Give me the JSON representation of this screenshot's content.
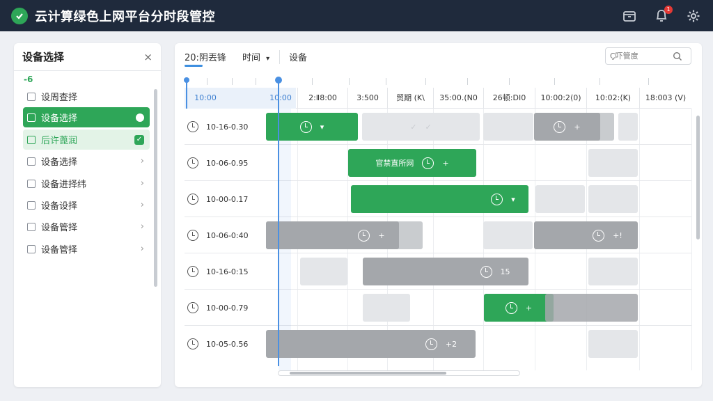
{
  "app": {
    "title": "云计算绿色上网平台分时段管控",
    "notification_count": "1"
  },
  "sidebar": {
    "title": "设备选择",
    "close": "×",
    "subtitle": "-6",
    "items": [
      {
        "label": "设周查择",
        "state": "normal",
        "trail": ""
      },
      {
        "label": "设备选择",
        "state": "active",
        "trail": ""
      },
      {
        "label": "后许蓖润",
        "state": "soft",
        "trail": "✓"
      },
      {
        "label": "设备选择",
        "state": "normal",
        "trail": "›"
      },
      {
        "label": "设备进择纬",
        "state": "normal",
        "trail": "›"
      },
      {
        "label": "设备设择",
        "state": "normal",
        "trail": "›"
      },
      {
        "label": "设备管择",
        "state": "normal",
        "trail": "›"
      },
      {
        "label": "设备管择",
        "state": "normal",
        "trail": "›"
      }
    ]
  },
  "toolbar": {
    "tab1": "20:阴丟锋",
    "tab2": "时间",
    "tab2_caret": "▾",
    "tab3": "设备",
    "search_placeholder": "Ç吓管度"
  },
  "columns": [
    "10:00",
    "10:00",
    "2:Ⅱ8:00",
    "3:500",
    "贸期 (K\\",
    "35:00.(Ν0",
    "26顿:DI0",
    "10:00:2⟨0)",
    "10:02:⟨K)",
    "18:003 (V)"
  ],
  "rows": [
    {
      "label": "10-16-0.30"
    },
    {
      "label": "10-06-0.95"
    },
    {
      "label": "10-00-0.17"
    },
    {
      "label": "10-06-0:40"
    },
    {
      "label": "10-16-0:15"
    },
    {
      "label": "10-00-0.79"
    },
    {
      "label": "10-05-0.56"
    }
  ],
  "bars": {
    "r1_a_icon": "▾",
    "r1_b_icon": "+",
    "r2_text": "官禁直所网",
    "r2_icon": "+",
    "r3_icon": "▾",
    "r4_a_icon": "+",
    "r4_b_icon": "+!",
    "r5_text": "15",
    "r6_icon": "+",
    "r7_text": "+2"
  },
  "tick": "✓",
  "colors": {
    "brand_green": "#2ea658",
    "accent_blue": "#4a90e2",
    "topbar": "#1f2a3c"
  }
}
